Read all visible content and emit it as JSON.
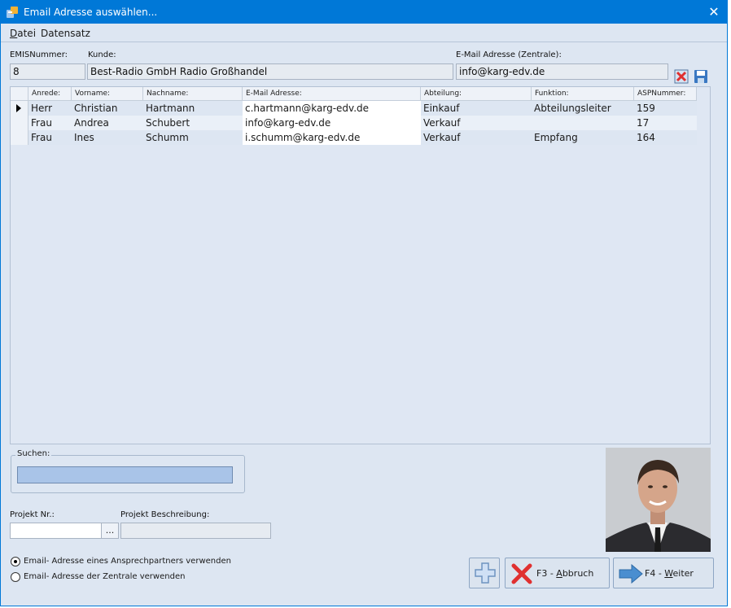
{
  "window": {
    "title": "Email Adresse auswählen...",
    "close": "✕"
  },
  "menu": {
    "datei": "Datei",
    "datensatz": "Datensatz"
  },
  "header": {
    "emis_label": "EMISNummer:",
    "emis_value": "8",
    "kunde_label": "Kunde:",
    "kunde_value": "Best-Radio GmbH Radio Großhandel",
    "email_label": "E-Mail Adresse (Zentrale):",
    "email_value": "info@karg-edv.de"
  },
  "grid": {
    "columns": [
      "Anrede:",
      "Vorname:",
      "Nachname:",
      "E-Mail Adresse:",
      "Abteilung:",
      "Funktion:",
      "ASPNummer:"
    ],
    "rows": [
      {
        "anrede": "Herr",
        "vorname": "Christian",
        "nachname": "Hartmann",
        "email": "c.hartmann@karg-edv.de",
        "abteilung": "Einkauf",
        "funktion": "Abteilungsleiter",
        "asp": "159"
      },
      {
        "anrede": "Frau",
        "vorname": "Andrea",
        "nachname": "Schubert",
        "email": "info@karg-edv.de",
        "abteilung": "Verkauf",
        "funktion": "",
        "asp": "17"
      },
      {
        "anrede": "Frau",
        "vorname": "Ines",
        "nachname": "Schumm",
        "email": "i.schumm@karg-edv.de",
        "abteilung": "Verkauf",
        "funktion": "Empfang",
        "asp": "164"
      }
    ]
  },
  "search": {
    "legend": "Suchen:",
    "value": ""
  },
  "project": {
    "nr_label": "Projekt Nr.:",
    "nr_value": "",
    "ellipsis": "...",
    "desc_label": "Projekt Beschreibung:",
    "desc_value": ""
  },
  "options": {
    "contact": "Email- Adresse eines Ansprechpartners verwenden",
    "central": "Email- Adresse der Zentrale verwenden",
    "selected": "contact"
  },
  "buttons": {
    "abbruch_key": "F3 - ",
    "abbruch_accel": "A",
    "abbruch_rest": "bbruch",
    "weiter_key": "F4 - ",
    "weiter_accel": "W",
    "weiter_rest": "eiter"
  },
  "colors": {
    "titlebar": "#0078d7",
    "window_bg": "#dde6f2",
    "delete_red": "#e03030",
    "arrow_blue": "#4a8ed0"
  }
}
